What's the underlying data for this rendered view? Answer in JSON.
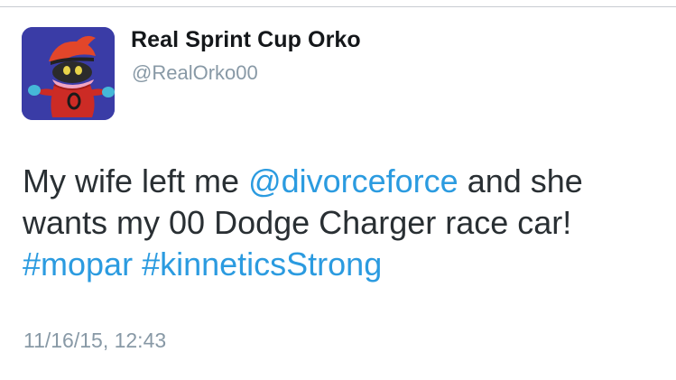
{
  "user": {
    "display_name": "Real Sprint Cup Orko",
    "handle": "@RealOrko00",
    "avatar_icon": "orko-character-avatar"
  },
  "tweet": {
    "part1": "My wife left me ",
    "mention": "@divorceforce",
    "part2": " and she wants my 00 Dodge Charger race car! ",
    "hashtag1": "#mopar",
    "space": " ",
    "hashtag2": "#kinneticsStrong",
    "timestamp": "11/16/15, 12:43"
  },
  "colors": {
    "link": "#2b9be0",
    "text": "#292f33",
    "muted": "#8899a6",
    "avatar_bg": "#3b3ea8"
  }
}
